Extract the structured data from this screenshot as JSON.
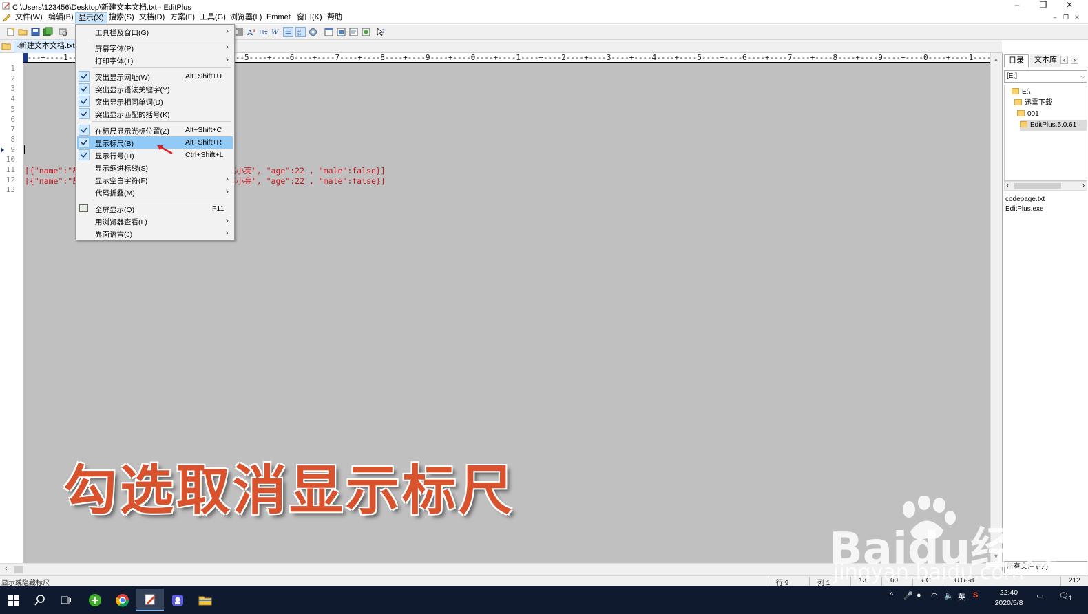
{
  "window": {
    "title": "C:\\Users\\123456\\Desktop\\新建文本文档.txt - EditPlus",
    "minimize": "–",
    "restore": "❐",
    "close": "✕"
  },
  "menubar": {
    "items": [
      "文件(W)",
      "编辑(B)",
      "显示(X)",
      "搜索(S)",
      "文档(D)",
      "方案(F)",
      "工具(G)",
      "浏览器(L)",
      "Emmet",
      "窗口(K)",
      "帮助"
    ],
    "active_index": 2
  },
  "tabs": {
    "document": "新建文本文档.txt"
  },
  "ruler": {
    "text": "----+----1----+----2----+----3----+----4----+----5----+----6----+----7----+----8----+----9----+----0----+----1----+----2----+----3----+----4----+----5----+----6----+----7----+----8----+----9----+----0----+----1----+----2"
  },
  "gutter": {
    "line_numbers": [
      "1",
      "2",
      "3",
      "4",
      "5",
      "6",
      "7",
      "8",
      "9",
      "10",
      "11",
      "12",
      "13"
    ],
    "current_line": 9
  },
  "editor": {
    "lines": [
      {
        "line": 11,
        "text": "[{\"name\":\"胡                         ame\":\"赵小亮\", \"age\":22 , \"male\":false}]"
      },
      {
        "line": 12,
        "text": "[{\"name\":\"胡                         ame\":\"赵小亮\", \"age\":22 , \"male\":false}]"
      }
    ]
  },
  "dropdown": {
    "items": [
      {
        "label": "工具栏及窗口(G)",
        "shortcut": "",
        "submenu": true,
        "checked": false
      },
      {
        "label": "屏幕字体(P)",
        "shortcut": "",
        "submenu": true,
        "checked": false
      },
      {
        "label": "打印字体(T)",
        "shortcut": "",
        "submenu": true,
        "checked": false
      },
      {
        "label": "突出显示网址(W)",
        "shortcut": "Alt+Shift+U",
        "submenu": false,
        "checked": true
      },
      {
        "label": "突出显示语法关键字(Y)",
        "shortcut": "",
        "submenu": false,
        "checked": true
      },
      {
        "label": "突出显示相同单词(D)",
        "shortcut": "",
        "submenu": false,
        "checked": true
      },
      {
        "label": "突出显示匹配的括号(K)",
        "shortcut": "",
        "submenu": false,
        "checked": true
      },
      {
        "label": "在标尺显示光标位置(Z)",
        "shortcut": "Alt+Shift+C",
        "submenu": false,
        "checked": true
      },
      {
        "label": "显示标尺(B)",
        "shortcut": "Alt+Shift+R",
        "submenu": false,
        "checked": true,
        "highlighted": true
      },
      {
        "label": "显示行号(H)",
        "shortcut": "Ctrl+Shift+L",
        "submenu": false,
        "checked": true
      },
      {
        "label": "显示缩进标线(S)",
        "shortcut": "",
        "submenu": false,
        "checked": false
      },
      {
        "label": "显示空白字符(F)",
        "shortcut": "",
        "submenu": true,
        "checked": false
      },
      {
        "label": "代码折叠(M)",
        "shortcut": "",
        "submenu": true,
        "checked": false
      },
      {
        "label": "全屏显示(Q)",
        "shortcut": "F11",
        "submenu": false,
        "checked": false
      },
      {
        "label": "用浏览器查看(L)",
        "shortcut": "",
        "submenu": true,
        "checked": false
      },
      {
        "label": "界面语言(J)",
        "shortcut": "",
        "submenu": true,
        "checked": false
      }
    ]
  },
  "right_panel": {
    "tabs": [
      "目录",
      "文本库"
    ],
    "drive": "[E:]",
    "tree": [
      "E:\\",
      "迅雷下载",
      "001",
      "EditPlus.5.0.61"
    ],
    "files": [
      "codepage.txt",
      "EditPlus.exe"
    ],
    "filter": "所有文件 (*.*)"
  },
  "statusbar": {
    "hint": "显示或隐藏标尺",
    "row": "行 9",
    "col": "列 1",
    "lines": "13",
    "ins": "00",
    "mode": "PC",
    "encoding": "UTF-8",
    "size": "212"
  },
  "taskbar": {
    "time": "22:40",
    "date": "2020/5/8",
    "ime": "英",
    "notification_count": "1"
  },
  "overlay": {
    "caption": "勾选取消显示标尺",
    "watermark_brand": "Baidu经验",
    "watermark_url": "jingyan.baidu.com"
  },
  "colors": {
    "accent": "#91c9f7",
    "code_text": "#c4161c",
    "caption": "#d8532d",
    "editor_bg": "#c0c0c0",
    "taskbar": "#0f1a2e"
  }
}
